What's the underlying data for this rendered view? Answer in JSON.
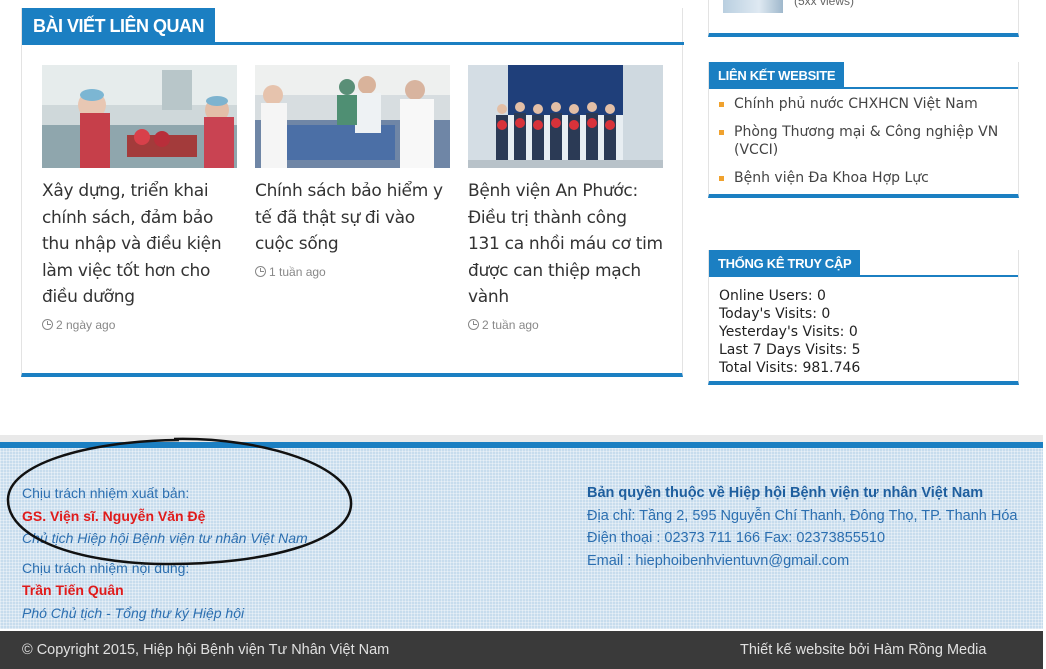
{
  "related": {
    "heading": "BÀI VIẾT LIÊN QUAN",
    "posts": [
      {
        "title": "Xây dựng, triển khai chính sách, đảm bảo thu nhập và điều kiện làm việc tốt hơn cho điều dưỡng",
        "date": "2 ngày ago"
      },
      {
        "title": "Chính sách bảo hiểm y tế đã thật sự đi vào cuộc sống",
        "date": "1 tuần ago"
      },
      {
        "title": "Bệnh viện An Phước: Điều trị thành công 131 ca nhồi máu cơ tim được can thiệp mạch vành",
        "date": "2 tuần ago"
      }
    ]
  },
  "sidebar": {
    "top_views": "(5xx views)",
    "links_widget": {
      "title": "LIÊN KẾT WEBSITE",
      "items": [
        "Chính phủ nước CHXHCN Việt Nam",
        "Phòng Thương mại & Công nghiệp VN (VCCI)",
        "Bệnh viện Đa Khoa Hợp Lực"
      ]
    },
    "stats_widget": {
      "title": "THỐNG KÊ TRUY CẬP",
      "lines": [
        "Online Users: 0",
        "Today's Visits: 0",
        "Yesterday's Visits: 0",
        "Last 7 Days Visits: 5",
        "Total Visits: 981.746"
      ]
    }
  },
  "footer": {
    "publisher_label": "Chịu trách nhiệm xuất bản:",
    "publisher_name": "GS. Viện sĩ. Nguyễn Văn Đệ",
    "publisher_role": "Chủ tịch Hiệp hội Bệnh viện tư nhân Việt Nam",
    "content_label": "Chịu trách nhiệm nội dung:",
    "content_name": "Trần Tiến Quân",
    "content_role": "Phó Chủ tịch - Tổng thư ký Hiệp hội",
    "copyright_owner": "Bản quyền thuộc về Hiệp hội Bệnh viện tư nhân Việt Nam",
    "address": "Địa chỉ: Tầng 2, 595 Nguyễn Chí Thanh, Đông Thọ, TP. Thanh Hóa",
    "phone": "Điện thoại : 02373 711 166 Fax: 02373855510",
    "email": "Email : hiephoibenhvientuvn@gmail.com",
    "bottom_copyright": "© Copyright 2015, Hiệp hội Bệnh viện Tư Nhân Việt Nam",
    "bottom_credit": "Thiết kế website bởi Hàm Rồng Media"
  }
}
